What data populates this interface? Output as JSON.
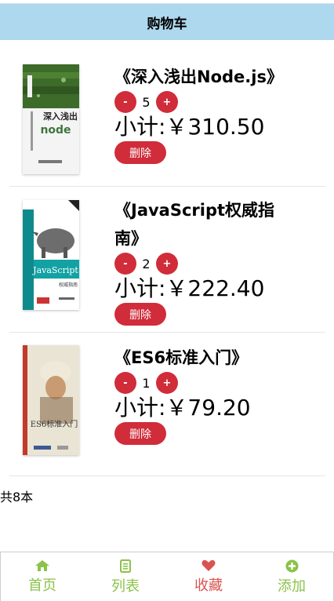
{
  "header": {
    "title": "购物车"
  },
  "items": [
    {
      "title": "《深入浅出Node.js》",
      "minus": "-",
      "qty": "5",
      "plus": "+",
      "subtotal": "小计:￥310.50",
      "delete": "删除",
      "cover_text": {
        "title": "深入浅出",
        "sub": "node"
      }
    },
    {
      "title": "《JavaScript权威指南》",
      "minus": "-",
      "qty": "2",
      "plus": "+",
      "subtotal": "小计:￥222.40",
      "delete": "删除",
      "cover_text": {
        "title": "JavaScript",
        "sub": "权威指南"
      }
    },
    {
      "title": "《ES6标准入门》",
      "minus": "-",
      "qty": "1",
      "plus": "+",
      "subtotal": "小计:￥79.20",
      "delete": "删除",
      "cover_text": {
        "title": "ES6标准入门"
      }
    }
  ],
  "summary": {
    "total": "共8本"
  },
  "tabbar": {
    "tabs": [
      {
        "label": "首页",
        "icon": "home-icon",
        "color": "#8bc34a"
      },
      {
        "label": "列表",
        "icon": "list-icon",
        "color": "#8bc34a"
      },
      {
        "label": "收藏",
        "icon": "heart-icon",
        "color": "#d9534f"
      },
      {
        "label": "添加",
        "icon": "plus-circle-icon",
        "color": "#8bc34a"
      }
    ]
  },
  "colors": {
    "header_bg": "#add8ee",
    "accent_red": "#d02c3a",
    "tab_green": "#8bc34a",
    "tab_red": "#d9534f"
  }
}
